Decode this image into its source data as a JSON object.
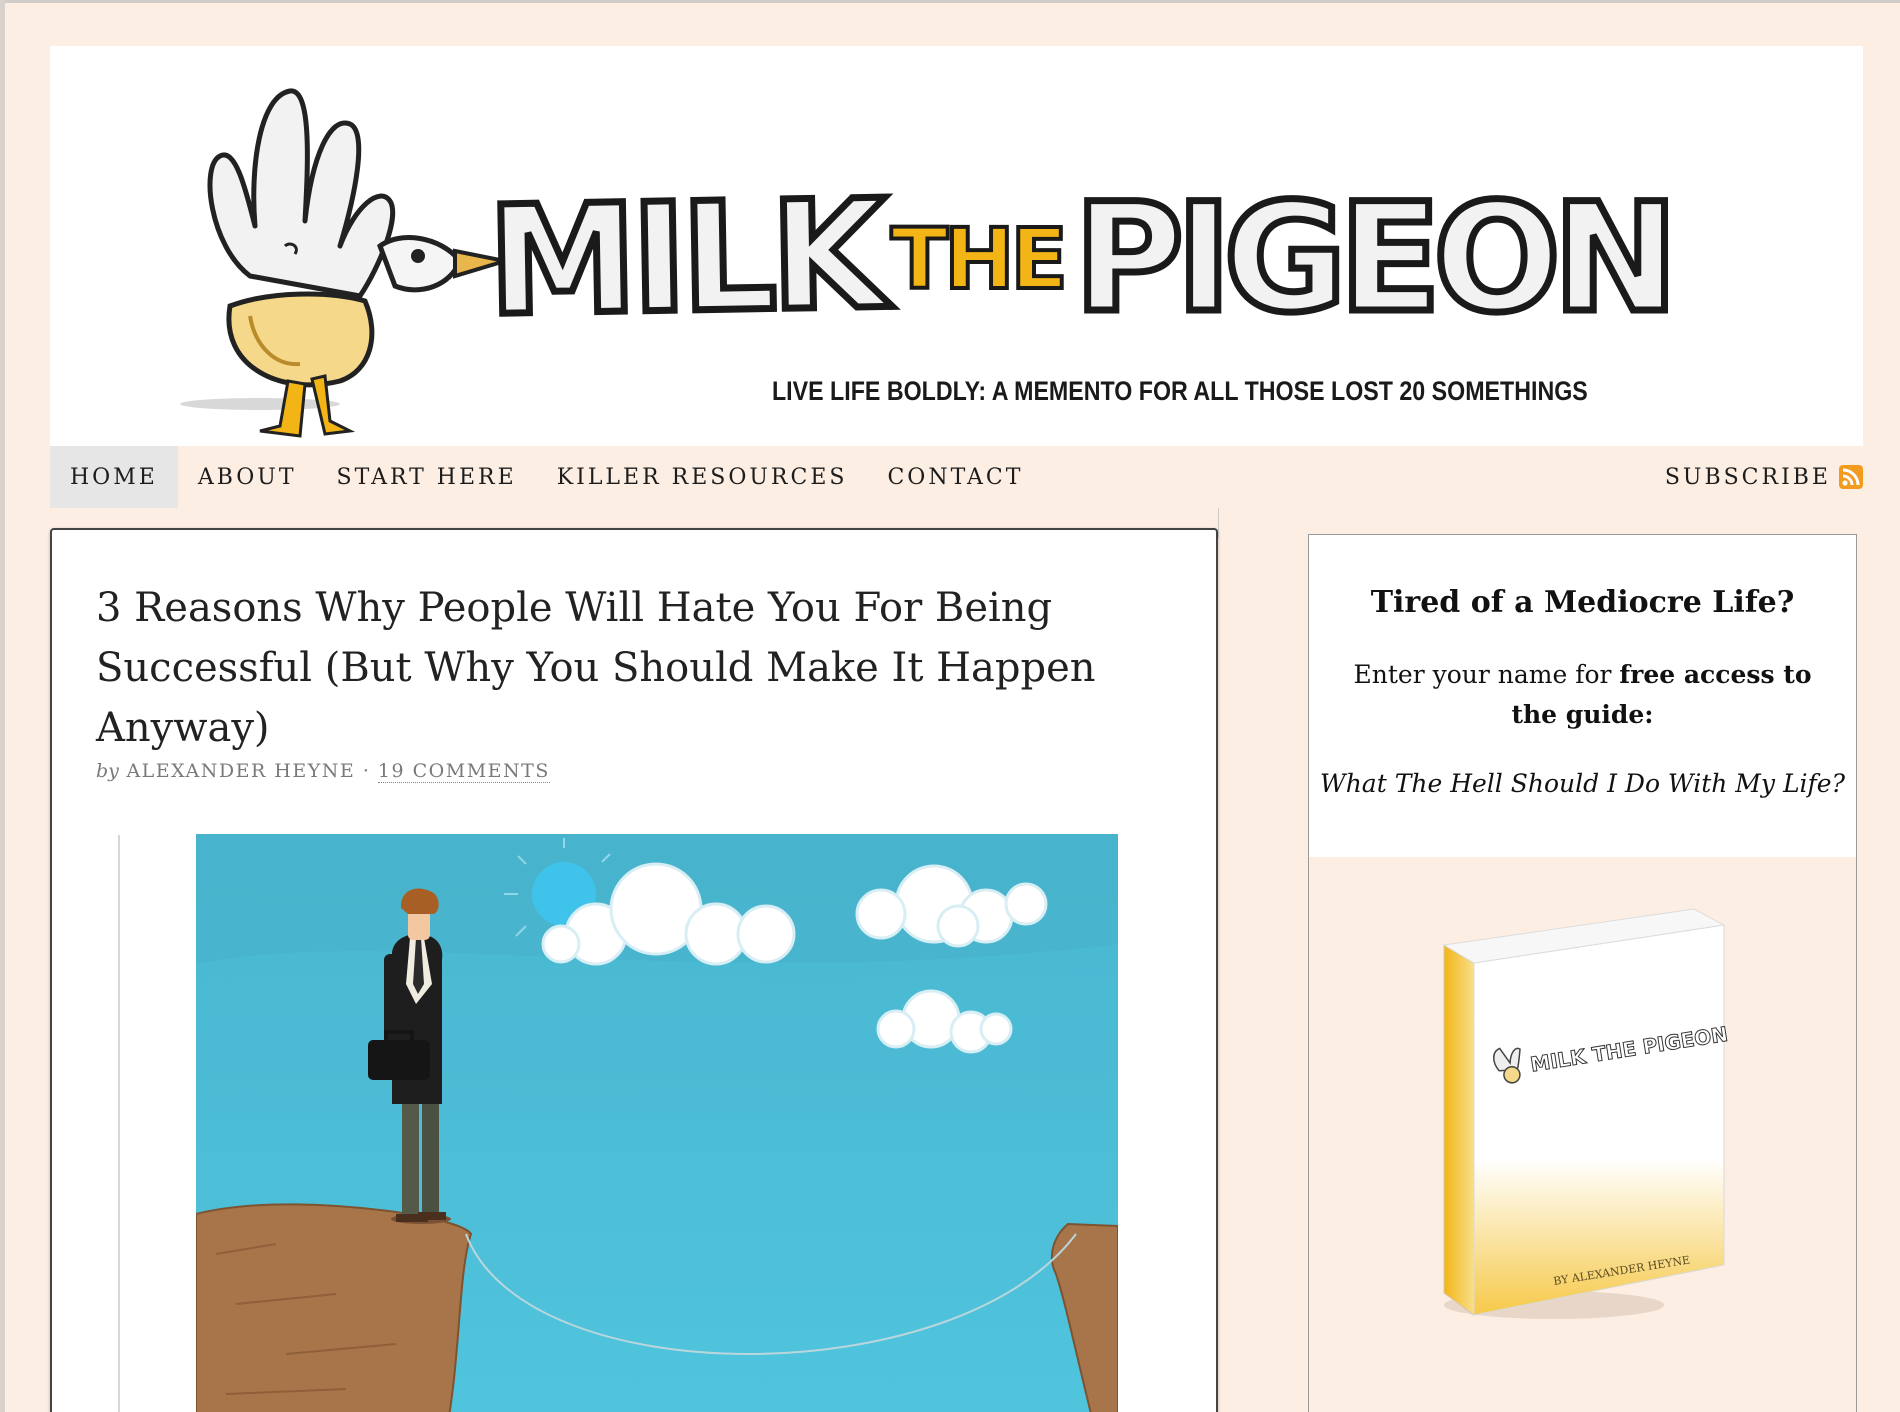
{
  "banner": {
    "logo_word_1": "MILK",
    "logo_word_2": "THE",
    "logo_word_3": "PIGEON",
    "tagline": "LIVE LIFE BOLDLY: A MEMENTO FOR ALL THOSE LOST 20 SOMETHINGS"
  },
  "nav": {
    "items": [
      {
        "label": "HOME",
        "active": true
      },
      {
        "label": "ABOUT",
        "active": false
      },
      {
        "label": "START HERE",
        "active": false
      },
      {
        "label": "KILLER RESOURCES",
        "active": false
      },
      {
        "label": "CONTACT",
        "active": false
      }
    ],
    "subscribe": "SUBSCRIBE",
    "subscribe_icon": "rss-icon"
  },
  "post": {
    "title": "3 Reasons Why People Will Hate You For Being Successful (But Why You Should Make It Happen Anyway)",
    "by": "by",
    "author": "ALEXANDER HEYNE",
    "separator": "·",
    "comments": "19 COMMENTS"
  },
  "sidebar": {
    "heading": "Tired of a Mediocre Life?",
    "body_pre": "Enter your name for ",
    "body_bold": "free access to the guide:",
    "guide_title": "What The Hell Should I Do With My Life?",
    "book_logo": "MILK THE PIGEON",
    "book_author": "BY ALEXANDER HEYNE"
  },
  "colors": {
    "page_background": "#fdeee3",
    "logo_accent": "#f2b515",
    "sky": "#4fc1dc",
    "cliff": "#a8754a"
  }
}
